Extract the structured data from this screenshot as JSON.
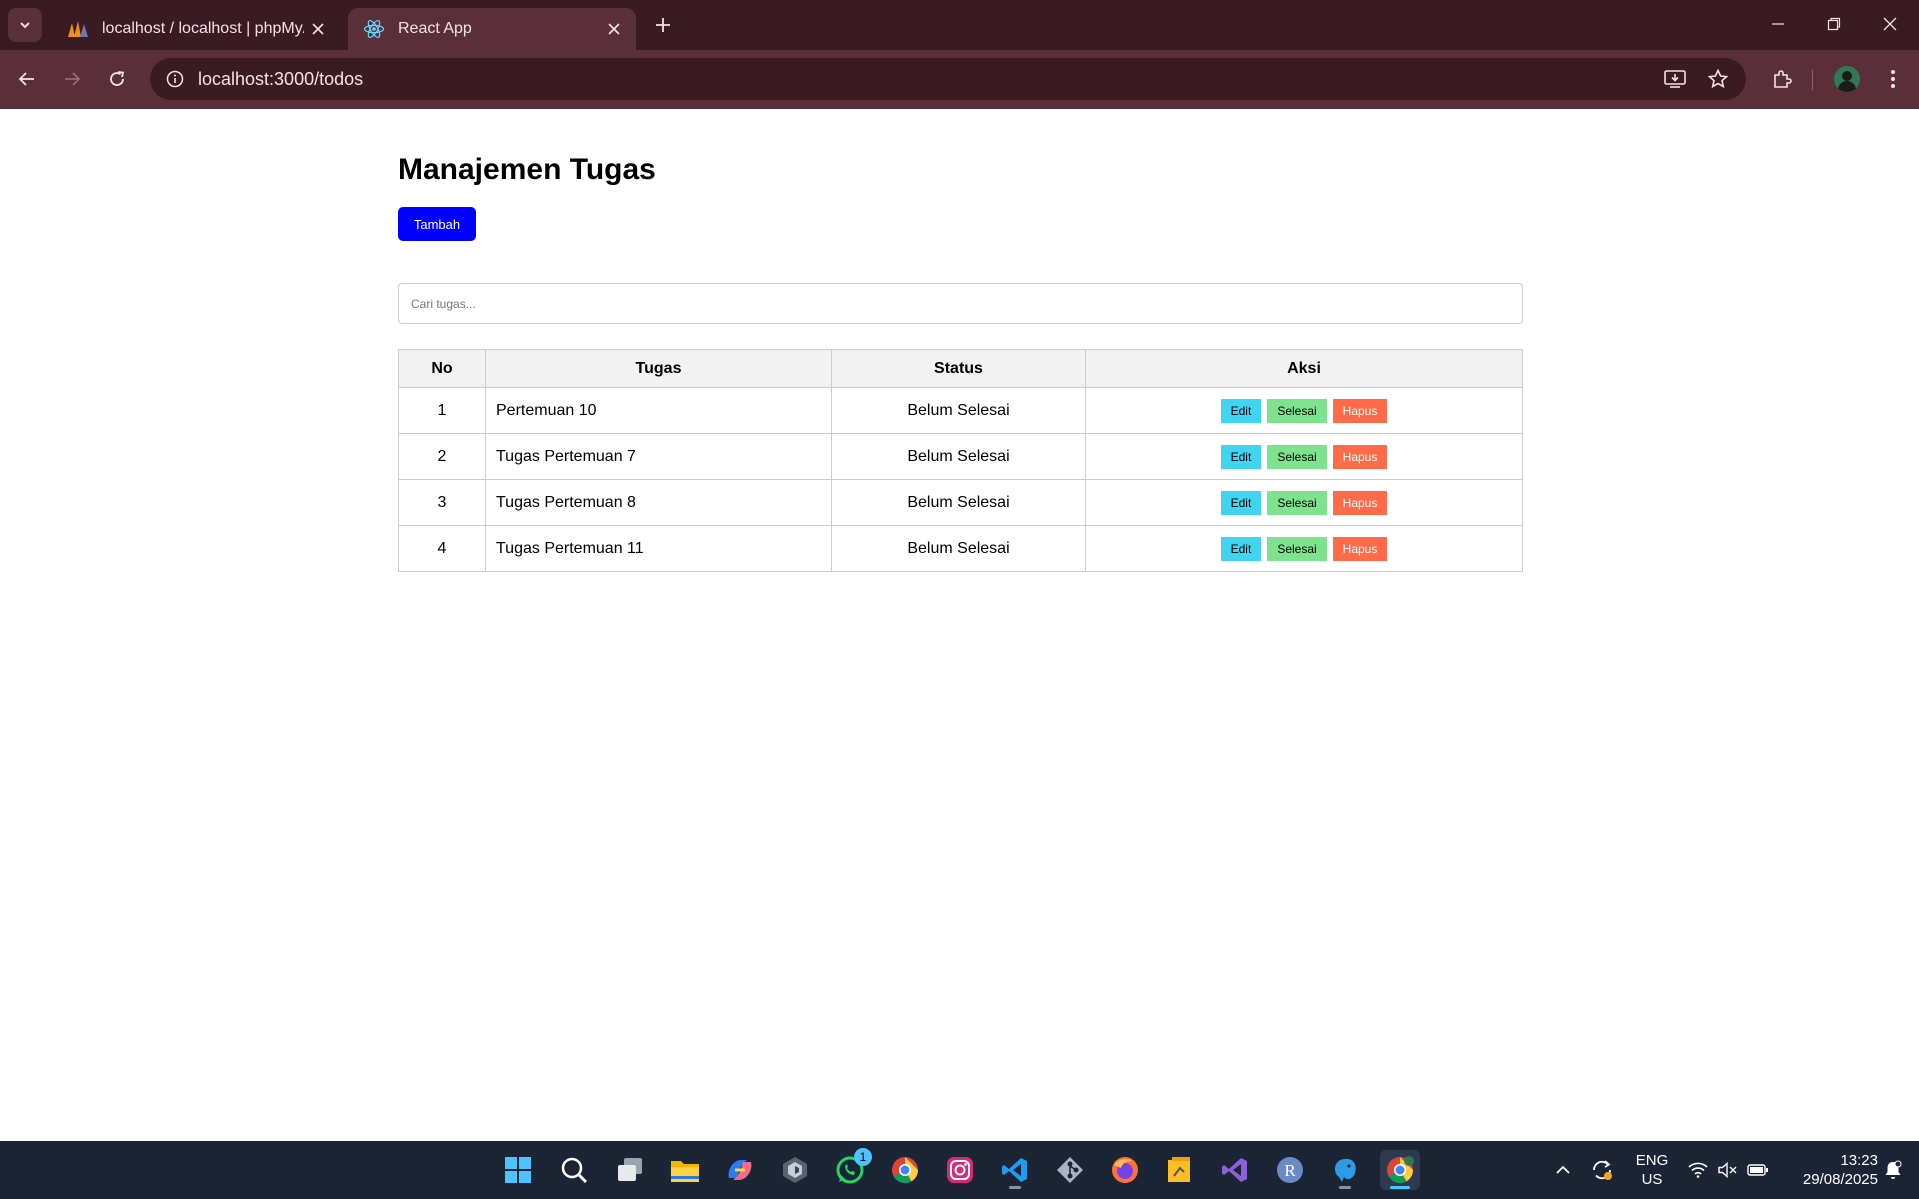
{
  "browser": {
    "tabs": [
      {
        "title": "localhost / localhost | phpMyAdmin",
        "active": false,
        "favicon": "phpmyadmin-icon"
      },
      {
        "title": "React App",
        "active": true,
        "favicon": "react-icon"
      }
    ],
    "address": "localhost:3000/todos"
  },
  "page": {
    "title": "Manajemen Tugas",
    "add_label": "Tambah",
    "search_placeholder": "Cari tugas...",
    "table": {
      "headers": {
        "no": "No",
        "task": "Tugas",
        "status": "Status",
        "actions": "Aksi"
      },
      "rows": [
        {
          "no": "1",
          "task": "Pertemuan 10",
          "status": "Belum Selesai"
        },
        {
          "no": "2",
          "task": "Tugas Pertemuan 7",
          "status": "Belum Selesai"
        },
        {
          "no": "3",
          "task": "Tugas Pertemuan 8",
          "status": "Belum Selesai"
        },
        {
          "no": "4",
          "task": "Tugas Pertemuan 11",
          "status": "Belum Selesai"
        }
      ],
      "action_labels": {
        "edit": "Edit",
        "done": "Selesai",
        "delete": "Hapus"
      }
    }
  },
  "colors": {
    "add": "#0000ff",
    "edit": "#40d4f0",
    "done": "#7fe28e",
    "delete": "#ff6a48"
  },
  "taskbar": {
    "apps": [
      "windows-start-icon",
      "search-icon",
      "task-view-icon",
      "file-explorer-icon",
      "copilot-icon",
      "app-icon",
      "whatsapp-icon",
      "chrome-icon",
      "instagram-icon",
      "vscode-icon",
      "git-icon",
      "firefox-icon",
      "sticky-notes-icon",
      "visual-studio-icon",
      "r-icon",
      "mysql-icon",
      "chrome-profile-icon"
    ],
    "whatsapp_badge": "1",
    "language": {
      "line1": "ENG",
      "line2": "US"
    },
    "time": "13:23",
    "date": "29/08/2025"
  }
}
